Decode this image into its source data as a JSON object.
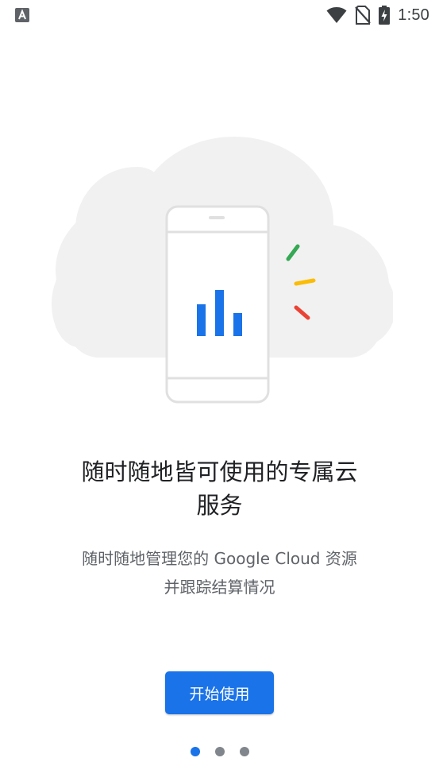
{
  "status_bar": {
    "time": "1:50",
    "left_icon": "app-notification-icon",
    "icons": [
      "wifi-icon",
      "no-sim-icon",
      "battery-charging-icon"
    ]
  },
  "illustration": {
    "icons": [
      "cloud-icon",
      "phone-icon",
      "bar-chart-icon",
      "sparkle-lines-icon"
    ],
    "colors": {
      "cloud": "#f1f1f1",
      "phone_outline": "#e0e0e0",
      "bars": "#1a73e8",
      "sparkle_green": "#34a853",
      "sparkle_yellow": "#fbbc04",
      "sparkle_red": "#ea4335"
    }
  },
  "onboarding": {
    "title_line1": "随时随地皆可使用的专属云",
    "title_line2": "服务",
    "description_line1": "随时随地管理您的 Google Cloud 资源",
    "description_line2": "并跟踪结算情况",
    "start_button_label": "开始使用"
  },
  "pager": {
    "total_pages": 3,
    "active_page": 1
  },
  "colors": {
    "accent": "#1a73e8",
    "title_text": "#202124",
    "body_text": "#5f6368",
    "inactive_dot": "#80868b"
  }
}
